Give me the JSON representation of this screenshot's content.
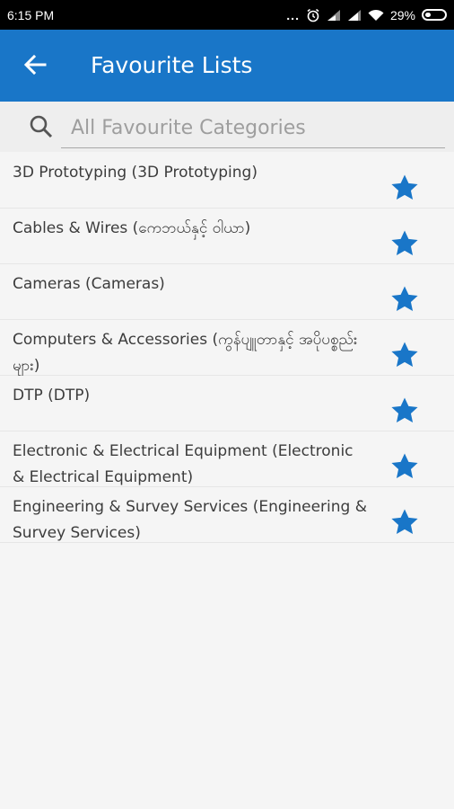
{
  "status_bar": {
    "time": "6:15 PM",
    "dots": "...",
    "battery_percent": "29%",
    "icons": [
      "alarm-icon",
      "signal-icon",
      "signal-icon",
      "wifi-icon",
      "battery-icon"
    ]
  },
  "app_bar": {
    "title": "Favourite Lists",
    "back_icon": "arrow-left-icon",
    "color": "#1976c8"
  },
  "search": {
    "placeholder": "All Favourite Categories",
    "value": "",
    "icon": "search-icon"
  },
  "list": {
    "star_color": "#1976c8",
    "items": [
      {
        "label": "3D Prototyping (3D Prototyping)",
        "favourite": true
      },
      {
        "label": "Cables & Wires (ကေဘယ်နှင့် ဝါယာ)",
        "favourite": true
      },
      {
        "label": "Cameras (Cameras)",
        "favourite": true
      },
      {
        "label": "Computers & Accessories (ကွန်ပျူတာနှင့် အပိုပစ္စည်းများ)",
        "favourite": true
      },
      {
        "label": "DTP (DTP)",
        "favourite": true
      },
      {
        "label": "Electronic & Electrical Equipment (Electronic & Electrical Equipment)",
        "favourite": true
      },
      {
        "label": "Engineering & Survey Services (Engineering & Survey Services)",
        "favourite": true
      }
    ]
  }
}
